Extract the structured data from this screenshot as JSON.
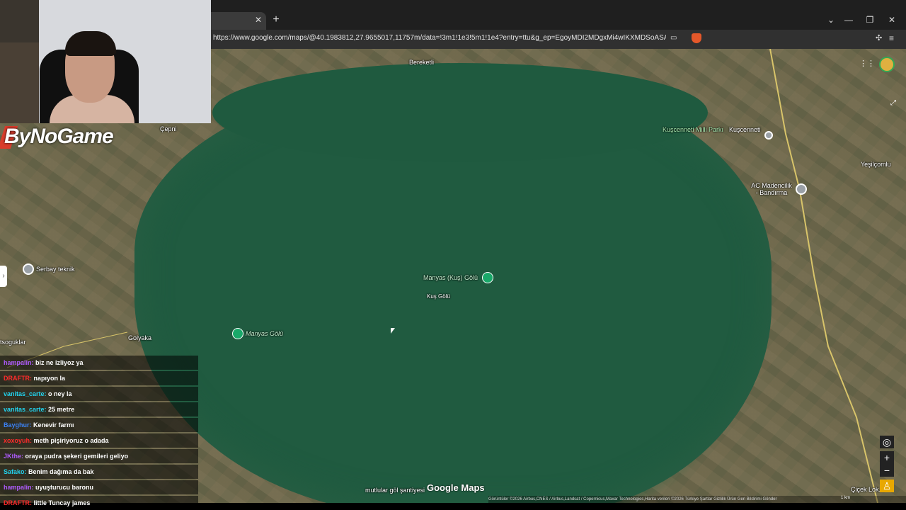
{
  "browser": {
    "url": "https://www.google.com/maps/@40.1983812,27.9655017,11757m/data=!3m1!1e3!5m1!1e4?entry=ttu&g_ep=EgoyMDI2MDgxMi4wIKXMDSoASAFQAw...",
    "tab_close": "✕",
    "new_tab": "+",
    "window_controls": [
      "⌄",
      "—",
      "❐",
      "✕"
    ]
  },
  "overlay": {
    "logo_text": "ByNoGame"
  },
  "map": {
    "places": {
      "bereketli": "Bereketli",
      "cepni": "Çepni",
      "kuscenneti_park": "Kuşcenneti Milli Parkı",
      "kuscenneti": "Kuşcenneti",
      "yesilcomlu": "Yeşilçomlu",
      "ac_madencilik": "AC Madencilik - Bandırma",
      "serbay": "Serbay teknik",
      "manyas_kus": "Manyas (Kuş) Gölü",
      "kus_golu": "Kuş Gölü",
      "manyas_golu": "Manyas Gölü",
      "golyaka": "Golyaka",
      "soguklar": "tsoguklar",
      "mutlular": "mutlular göl şantiyesi",
      "cicek": "Çiçek Lok..."
    },
    "logo": "Google Maps",
    "attribution": "Görüntüler ©2026 Airbus,CNES / Airbus,Landsat / Copernicus,Maxar Technologies,Harita verileri ©2026   Türkiye   Şartlar   Gizlilik   Ürün Geri Bildirimi Gönder",
    "scale": "1 km",
    "controls": {
      "zoom_in": "+",
      "zoom_out": "−"
    }
  },
  "chat": [
    {
      "user": "hampalin",
      "text": "biz ne izliyoz ya",
      "color": "#b05cff"
    },
    {
      "user": "DRAFTR",
      "text": "napıyon la",
      "color": "#ff2b2b"
    },
    {
      "user": "vanitas_carte",
      "text": "o ney la",
      "color": "#22d3ee"
    },
    {
      "user": "vanitas_carte",
      "text": "25 metre",
      "color": "#22d3ee"
    },
    {
      "user": "Bayghur",
      "text": "Kenevir farmı",
      "color": "#3b82f6"
    },
    {
      "user": "xoxoyuh",
      "text": "meth pişiriyoruz o adada",
      "color": "#ff2b2b"
    },
    {
      "user": "JKthe",
      "text": "oraya pudra şekeri gemileri geliyo",
      "color": "#b05cff"
    },
    {
      "user": "Safako",
      "text": "Benim dağıma da bak",
      "color": "#22d3ee"
    },
    {
      "user": "hampalin",
      "text": "uyuşturucu baronu",
      "color": "#b05cff"
    },
    {
      "user": "DRAFTR",
      "text": "little Tuncay james",
      "color": "#ff2b2b"
    }
  ]
}
